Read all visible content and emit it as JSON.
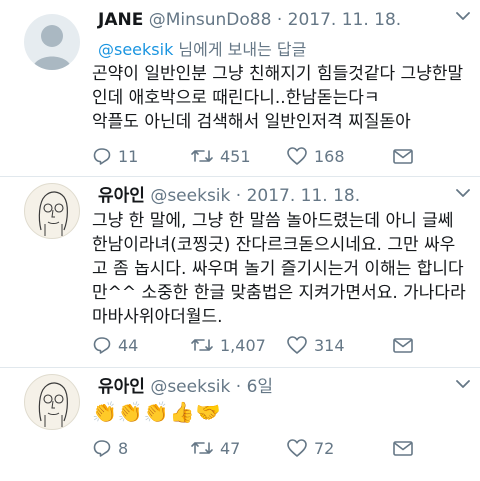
{
  "tweets": [
    {
      "name": "JANE",
      "handle": "@MinsunDo88",
      "separator": " · ",
      "date": "2017. 11. 18.",
      "reply_mention": "@seeksik",
      "reply_suffix": " 님에게 보내는 답글",
      "lines": [
        "곤약이 일반인분 그냥 친해지기 힘들것같다 그냥한말",
        "인데 애호박으로 때린다니..한남돋는다ㅋ",
        "악플도 아닌데 검색해서 일반인저격 찌질돋아"
      ],
      "replies": "11",
      "retweets": "451",
      "likes": "168"
    },
    {
      "name": "유아인",
      "handle": "@seeksik",
      "separator": " · ",
      "date": "2017. 11. 18.",
      "lines": [
        "그냥 한 말에, 그냥 한 말씀 놀아드렸는데 아니 글쎄",
        "한남이라녀(코찡긋) 잔다르크돋으시네요. 그만 싸우",
        "고 좀 놉시다. 싸우며 놀기 즐기시는거 이해는 합니다",
        "만^^ 소중한 한글 맞춤법은 지켜가면서요. 가나다라",
        "마바사위아더월드."
      ],
      "replies": "44",
      "retweets": "1,407",
      "likes": "314"
    },
    {
      "name": "유아인",
      "handle": "@seeksik",
      "separator": " · ",
      "date": "6일",
      "lines": [
        "👏👏👏👍🤝"
      ],
      "replies": "8",
      "retweets": "47",
      "likes": "72"
    }
  ],
  "icons": {
    "reply": "reply-icon",
    "retweet": "retweet-icon",
    "like": "heart-icon",
    "more": "chevron-down-icon"
  },
  "colors": {
    "text": "#14171a",
    "muted": "#657786",
    "link": "#1b95e0",
    "divider": "#e1e8ed"
  }
}
